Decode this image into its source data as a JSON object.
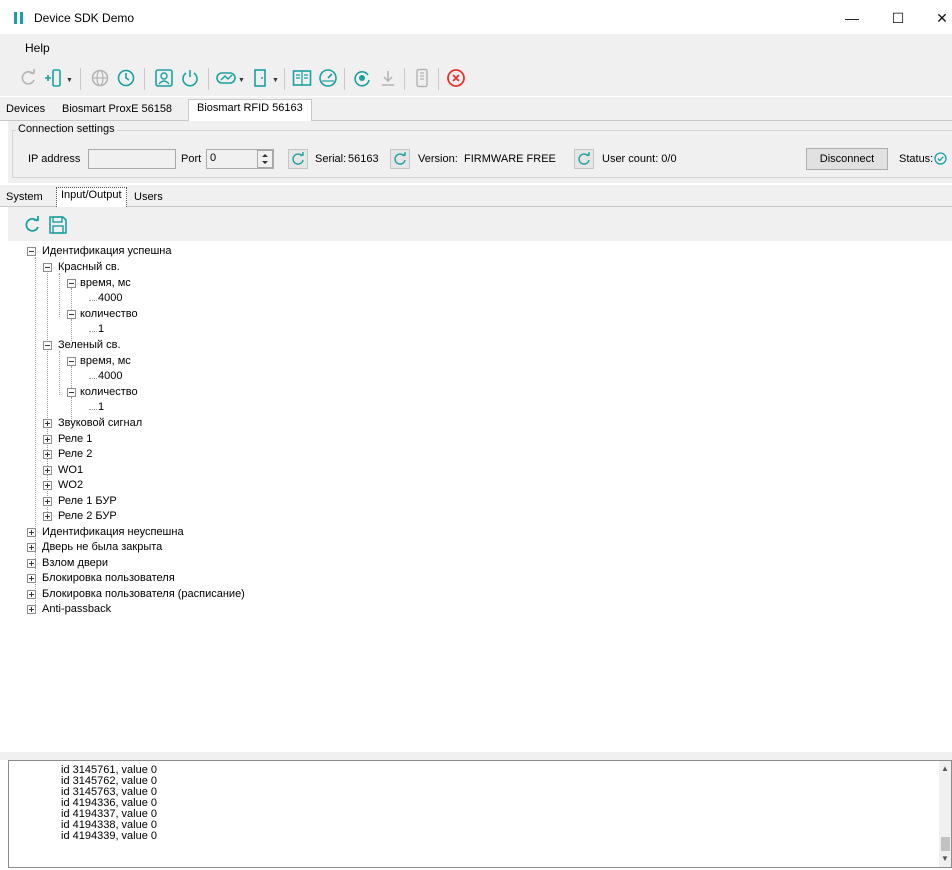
{
  "window": {
    "title": "Device SDK Demo",
    "minimize_glyph": "—",
    "maximize_glyph": "☐",
    "close_glyph": "✕"
  },
  "menu": {
    "items": [
      {
        "label": "Help"
      }
    ]
  },
  "toolbar": {
    "icons": [
      "refresh-icon",
      "add-device-icon",
      "globe-icon",
      "clock-icon",
      "user-card-icon",
      "power-icon",
      "gauge-chain-icon",
      "door-icon",
      "book-icon",
      "speedometer-icon",
      "eye-sync-icon",
      "download-icon",
      "reader-icon",
      "stop-icon"
    ],
    "accent_color": "#1aa0a0",
    "stop_color": "#e0362b"
  },
  "device_tabs": [
    {
      "label": "Devices"
    },
    {
      "label": "Biosmart ProxE 56158"
    },
    {
      "label": "Biosmart RFID 56163",
      "active": true
    }
  ],
  "connection": {
    "group_label": "Connection settings",
    "ip_label": "IP address",
    "ip_value": "",
    "port_label": "Port",
    "port_value": "0",
    "serial_label": "Serial:",
    "serial_value": "56163",
    "version_label": "Version:",
    "version_value": "FIRMWARE FREE",
    "user_count": "User count: 0/0",
    "disconnect_label": "Disconnect",
    "status_label": "Status:"
  },
  "section_tabs": [
    {
      "label": "System"
    },
    {
      "label": "Input/Output",
      "active": true
    },
    {
      "label": "Users"
    }
  ],
  "tree": {
    "nodes": [
      {
        "label": "Идентификация успешна"
      },
      {
        "label": "Красный св."
      },
      {
        "label": "время, мс"
      },
      {
        "label": "4000"
      },
      {
        "label": "количество"
      },
      {
        "label": "1"
      },
      {
        "label": "Зеленый св."
      },
      {
        "label": "время, мс"
      },
      {
        "label": "4000"
      },
      {
        "label": "количество"
      },
      {
        "label": "1"
      },
      {
        "label": "Звуковой сигнал"
      },
      {
        "label": "Реле 1"
      },
      {
        "label": "Реле 2"
      },
      {
        "label": "WO1"
      },
      {
        "label": "WO2"
      },
      {
        "label": "Реле 1 БУР"
      },
      {
        "label": "Реле 2 БУР"
      },
      {
        "label": "Идентификация неуспешна"
      },
      {
        "label": "Дверь не была закрыта"
      },
      {
        "label": "Взлом двери"
      },
      {
        "label": "Блокировка пользователя"
      },
      {
        "label": "Блокировка пользователя (расписание)"
      },
      {
        "label": "Anti-passback"
      }
    ]
  },
  "log": {
    "lines": [
      "id 3145761, value 0",
      "id 3145762, value 0",
      "id 3145763, value 0",
      "id 4194336, value 0",
      "id 4194337, value 0",
      "id 4194338, value 0",
      "id 4194339, value 0"
    ]
  }
}
